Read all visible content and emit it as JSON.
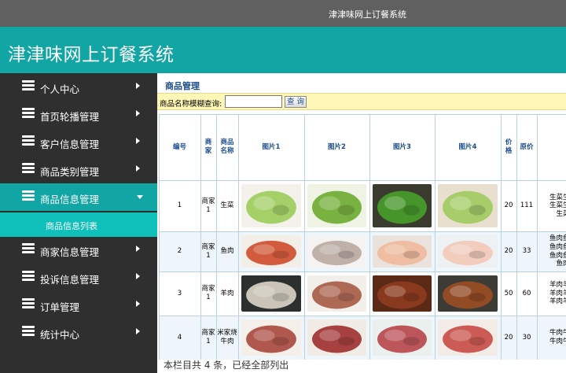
{
  "window": {
    "title": "津津味网上订餐系统"
  },
  "banner": {
    "title": "津津味网上订餐系统"
  },
  "sidebar": {
    "items": [
      {
        "label": "个人中心"
      },
      {
        "label": "首页轮播管理"
      },
      {
        "label": "客户信息管理"
      },
      {
        "label": "商品类别管理"
      },
      {
        "label": "商品信息管理"
      },
      {
        "label": "商家信息管理"
      },
      {
        "label": "投诉信息管理"
      },
      {
        "label": "订单管理"
      },
      {
        "label": "统计中心"
      }
    ],
    "active_index": 4,
    "submenu": {
      "label": "商品信息列表"
    }
  },
  "page": {
    "title": "商品管理",
    "search": {
      "label": "商品名称模糊查询:",
      "value": "",
      "button": "查 询"
    }
  },
  "table": {
    "headers": [
      "编号",
      "商家",
      "商品名称",
      "图片1",
      "图片2",
      "图片3",
      "图片4",
      "价格",
      "原价"
    ],
    "rows": [
      {
        "id": "1",
        "merchant": "商家1",
        "name": "生菜",
        "price": "20",
        "orig": "111",
        "desc": [
          "生菜生菜",
          "生菜生菜",
          "生菜"
        ],
        "images": [
          {
            "depicts": "lettuce on wooden plate",
            "bg": "#f4f1ea",
            "main": "#9ccc5a"
          },
          {
            "depicts": "lettuce head",
            "bg": "#eef3e4",
            "main": "#6cab2f"
          },
          {
            "depicts": "lettuce leaves",
            "bg": "#3a3a2e",
            "main": "#48a02a"
          },
          {
            "depicts": "lettuce dish",
            "bg": "#e9dfcf",
            "main": "#9fcb5e"
          }
        ]
      },
      {
        "id": "2",
        "merchant": "商家1",
        "name": "鱼肉",
        "price": "20",
        "orig": "33",
        "desc": [
          "鱼肉鱼肉",
          "鱼肉鱼肉",
          "鱼肉鱼肉",
          "鱼肉"
        ],
        "images": [
          {
            "depicts": "spicy fish dish",
            "bg": "#f3eee8",
            "main": "#cf4a2a"
          },
          {
            "depicts": "raw fish pieces",
            "bg": "#f5f3f1",
            "main": "#b9a8a0"
          },
          {
            "depicts": "fish fillet",
            "bg": "#eae3dd",
            "main": "#f0b89a"
          },
          {
            "depicts": "fish slices",
            "bg": "#eef1f3",
            "main": "#f2c9b8"
          }
        ]
      },
      {
        "id": "3",
        "merchant": "商家1",
        "name": "羊肉",
        "price": "50",
        "orig": "60",
        "desc": [
          "羊肉羊肉",
          "羊肉羊肉",
          "羊肉羊肉"
        ],
        "images": [
          {
            "depicts": "mutton soup",
            "bg": "#2b2f2e",
            "main": "#dcd6c8"
          },
          {
            "depicts": "mutton slices",
            "bg": "#f2eeea",
            "main": "#a65a45"
          },
          {
            "depicts": "braised mutton",
            "bg": "#5a2a17",
            "main": "#8e3b1e"
          },
          {
            "depicts": "mutton stew",
            "bg": "#3c3b36",
            "main": "#9a4e23"
          }
        ]
      },
      {
        "id": "4",
        "merchant": "商家1",
        "name": "米家烧牛肉",
        "price": "20",
        "orig": "30",
        "desc": [
          "牛肉牛肉",
          "牛肉牛肉"
        ],
        "images": [
          {
            "depicts": "sliced beef",
            "bg": "#f4efe8",
            "main": "#a9463d"
          },
          {
            "depicts": "raw beef",
            "bg": "#f1ebe6",
            "main": "#9e2f2c"
          },
          {
            "depicts": "beef steak",
            "bg": "#eaf0ee",
            "main": "#b8454a"
          },
          {
            "depicts": "beef chunk",
            "bg": "#f3ece6",
            "main": "#c64b44"
          }
        ]
      }
    ]
  },
  "footer": {
    "text": "本栏目共 4 条，已经全部列出"
  },
  "colors": {
    "topbar": "#606060",
    "banner": "#11a5a3",
    "sidebar": "#2f2f2f",
    "active": "#11a5a3",
    "header_text": "#1c4d8c",
    "searchbar": "#fff7b8"
  }
}
